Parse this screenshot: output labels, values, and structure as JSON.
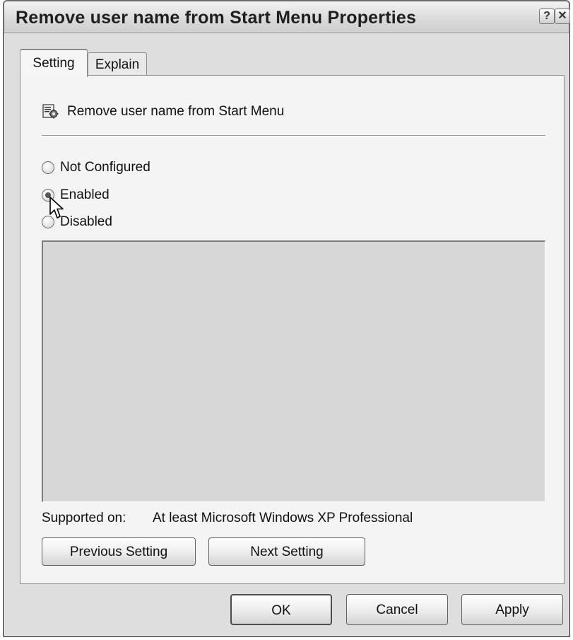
{
  "window": {
    "title": "Remove user name from Start Menu Properties",
    "help_button": "?",
    "close_button": "✕"
  },
  "tabs": [
    {
      "label": "Setting",
      "selected": true
    },
    {
      "label": "Explain",
      "selected": false
    }
  ],
  "policy": {
    "name": "Remove user name from Start Menu",
    "icon": "policy-settings-icon"
  },
  "options": [
    {
      "label": "Not Configured",
      "checked": false
    },
    {
      "label": "Enabled",
      "checked": true
    },
    {
      "label": "Disabled",
      "checked": false
    }
  ],
  "supported": {
    "label": "Supported on:",
    "value": "At least Microsoft Windows XP Professional"
  },
  "nav_buttons": {
    "previous": "Previous Setting",
    "next": "Next Setting"
  },
  "footer_buttons": {
    "ok": "OK",
    "cancel": "Cancel",
    "apply": "Apply"
  }
}
